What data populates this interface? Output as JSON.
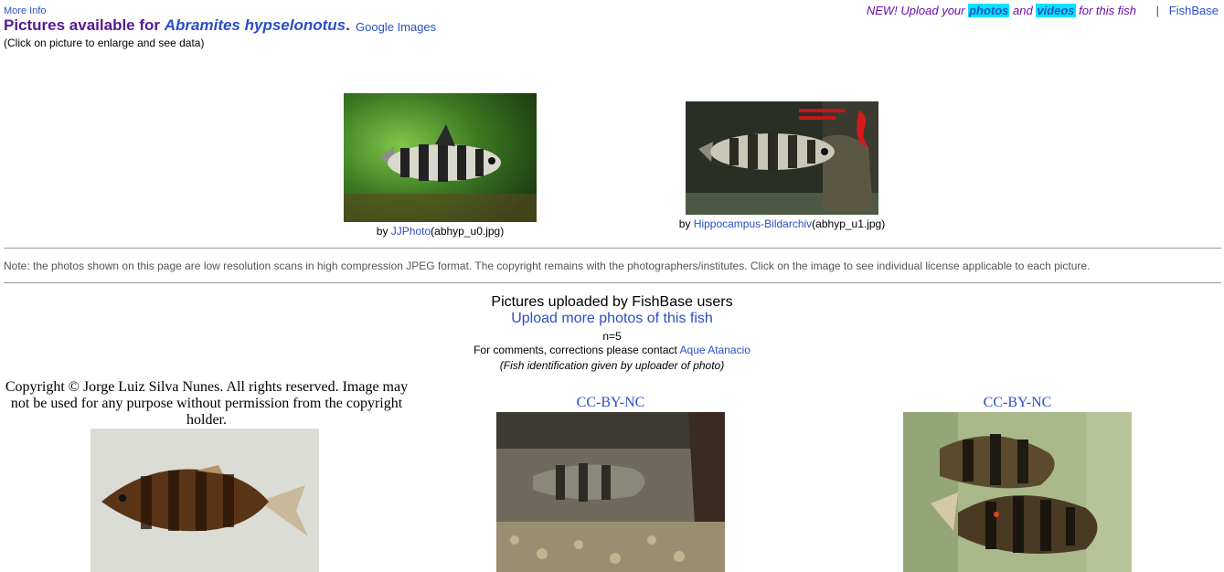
{
  "header": {
    "more_info": "More Info",
    "title_prefix": "Pictures available for ",
    "species": "Abramites hypselonotus",
    "title_suffix": ".",
    "google_images": "Google Images",
    "hint": "(Click on picture to enlarge and see data)"
  },
  "upload_banner": {
    "pre": "NEW! Upload your ",
    "photos": "photos",
    "and": " and ",
    "videos": "videos",
    "post": " for this fish",
    "separator": "|",
    "fishbase": "FishBase"
  },
  "gallery": [
    {
      "by": "by ",
      "author": "JJPhoto",
      "file": "(abhyp_u0.jpg)"
    },
    {
      "by": "by ",
      "author": "Hippocampus-Bildarchiv",
      "file": "(abhyp_u1.jpg)"
    }
  ],
  "note": "Note: the photos shown on this page are low resolution scans in high compression JPEG format. The copyright remains with the photographers/institutes. Click on the image to see individual license applicable to each picture.",
  "user_uploads": {
    "title": "Pictures uploaded by FishBase users",
    "upload_more": "Upload more photos of this fish",
    "count": "n=5",
    "contact_pre": "For comments, corrections please contact ",
    "contact_name": "Aque Atanacio",
    "fish_id_note": "(Fish identification given by uploader of photo)",
    "items": [
      {
        "rights": "Copyright © Jorge Luiz Silva Nunes. All rights reserved. Image may not be used for any purpose without permission from the copyright holder."
      },
      {
        "rights": "CC-BY-NC"
      },
      {
        "rights": "CC-BY-NC"
      }
    ]
  }
}
